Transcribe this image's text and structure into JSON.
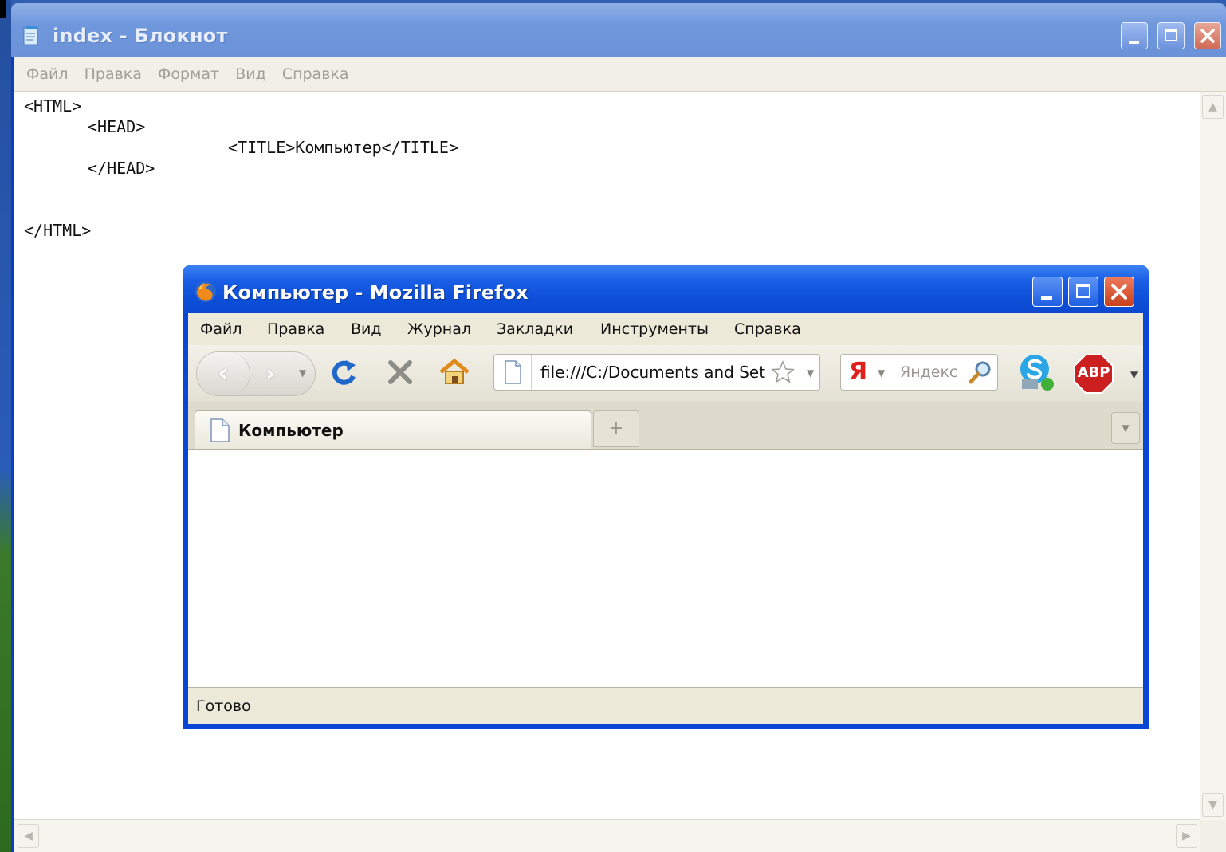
{
  "notepad": {
    "title": "index - Блокнот",
    "menu": [
      "Файл",
      "Правка",
      "Формат",
      "Вид",
      "Справка"
    ],
    "code_lines": [
      "<HTML>",
      "<HEAD>",
      "<TITLE>Компьютер</TITLE>",
      "</HEAD>",
      "</HTML>"
    ],
    "icons": [
      "notepad-icon",
      "minimize-icon",
      "maximize-icon",
      "close-icon"
    ]
  },
  "firefox": {
    "title": "Компьютер - Mozilla Firefox",
    "menu": [
      "Файл",
      "Правка",
      "Вид",
      "Журнал",
      "Закладки",
      "Инструменты",
      "Справка"
    ],
    "url": "file:///C:/Documents and Set",
    "search_placeholder": "Яндекс",
    "search_engine_letter": "Я",
    "tab_label": "Компьютер",
    "status_text": "Готово",
    "adblock_label": "ABP",
    "accent_color": "#0a46d6",
    "icons": [
      "firefox-icon",
      "back-icon",
      "forward-icon",
      "reload-icon",
      "stop-icon",
      "home-icon",
      "page-icon",
      "star-icon",
      "search-icon",
      "skype-icon",
      "adblock-icon"
    ]
  }
}
